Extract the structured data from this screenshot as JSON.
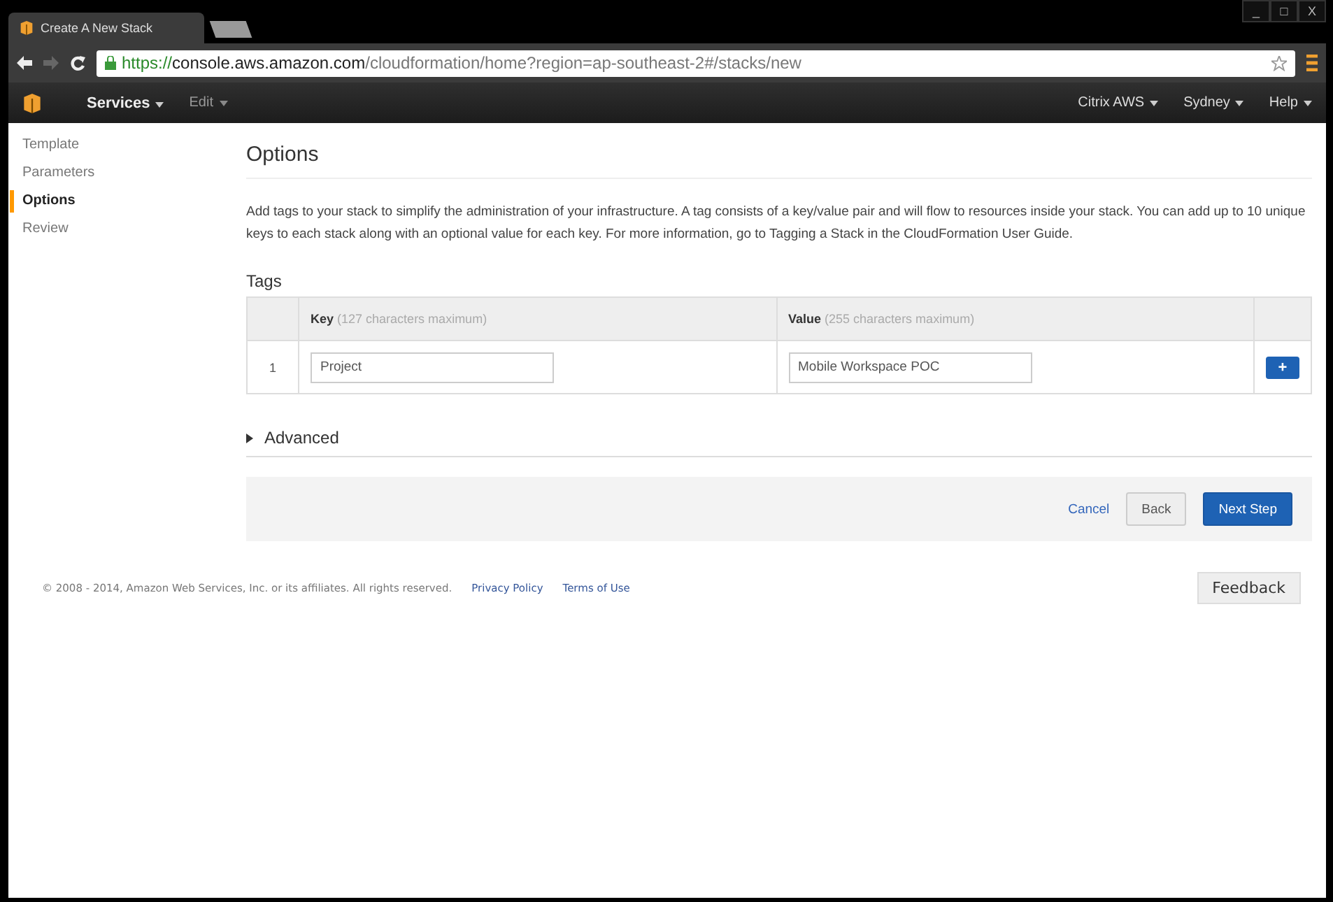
{
  "browser": {
    "tab_title": "Create A New Stack",
    "url_scheme": "https://",
    "url_host": "console.aws.amazon.com",
    "url_path": "/cloudformation/home?region=ap-southeast-2#/stacks/new",
    "window_controls": [
      "_",
      "□",
      "X"
    ]
  },
  "navbar": {
    "left": [
      {
        "label": "Services",
        "bold": true
      },
      {
        "label": "Edit",
        "bold": false
      }
    ],
    "right": [
      "Citrix AWS",
      "Sydney",
      "Help"
    ]
  },
  "steps": [
    {
      "label": "Template",
      "selected": false
    },
    {
      "label": "Parameters",
      "selected": false
    },
    {
      "label": "Options",
      "selected": true
    },
    {
      "label": "Review",
      "selected": false
    }
  ],
  "page_title": "Options",
  "description": "Add tags to your stack to simplify the administration of your infrastructure. A tag consists of a key/value pair and will flow to resources inside your stack. You can add up to 10 unique keys to each stack along with an optional value for each key. For more information, go to Tagging a Stack in the CloudFormation User Guide.",
  "tags": {
    "title": "Tags",
    "columns": [
      {
        "name": "Key",
        "hint": "(127 characters maximum)"
      },
      {
        "name": "Value",
        "hint": "(255 characters maximum)"
      }
    ],
    "rows": [
      {
        "index": "1",
        "key": "Project",
        "value": "Mobile Workspace POC"
      }
    ],
    "add_button": "+"
  },
  "advanced": {
    "label": "Advanced",
    "expanded": false
  },
  "actions": {
    "cancel": "Cancel",
    "back": "Back",
    "next": "Next Step"
  },
  "footer": {
    "copyright": "© 2008 - 2014, Amazon Web Services, Inc. or its affiliates. All rights reserved.",
    "links": [
      "Privacy Policy",
      "Terms of Use"
    ],
    "feedback": "Feedback"
  }
}
